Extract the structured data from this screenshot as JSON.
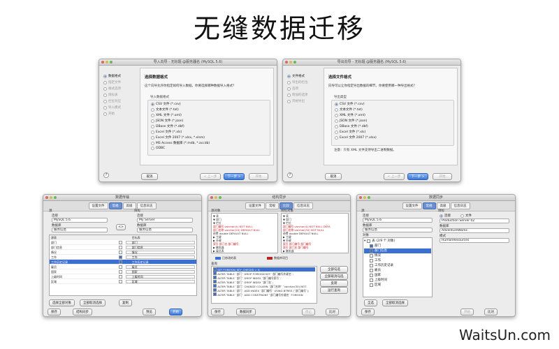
{
  "hero_title": "无缝数据迁移",
  "watermark": "WaitsUn.com",
  "import_win": {
    "title": "导入向导 - 无标题 @服务器名 (MySQL 5.6)",
    "steps": [
      "数据格式",
      "指定文件",
      "格式选项",
      "目标表",
      "栏位对应",
      "导入模式",
      "开始"
    ],
    "panel_title": "选择数据格式",
    "panel_desc": "这个向导允许你指定如何导入数据。你要选择哪种数据导入格式？",
    "group_label": "导入数据格式",
    "formats": [
      "CSV 文件 (*.csv)",
      "文本文件 (*.txt)",
      "XML 文件 (*.xml)",
      "JSON 文件 (*.json)",
      "DBase 文件 (*.dbf)",
      "Excel 文件 (*.xls)",
      "Excel 文件 2007 (*.xlsx, *.xlsm)",
      "MS Access 数据库 (*.mdb, *.accdb)",
      "ODBC"
    ],
    "cancel": "取消",
    "back": "< 上一步",
    "next": "下一步 >",
    "start": "开始",
    "help": "?"
  },
  "export_win": {
    "title": "导出向导 - 无标题 @服务器名 (MySQL 5.6)",
    "steps": [
      "文件格式",
      "导出的栏位",
      "选项",
      "附加的选项",
      "开始导出"
    ],
    "panel_title": "选择文件格式",
    "panel_desc": "向导可以让你指定导出数据的细节。你要使用哪一种导出格式？",
    "group_label": "导出类型",
    "formats": [
      "CSV 文件 (*.csv)",
      "文本文件 (*.txt)",
      "XML 文件 (*.xml)",
      "JSON 文件 (*.json)",
      "DBase 文件 (*.dbf)",
      "Excel 文件 (*.xls)",
      "Excel 文件 2007 (*.xlsx)"
    ],
    "note": "注意：只有 XML 文件支持导出二进制数据。",
    "cancel": "取消",
    "back": "< 上一步",
    "next": "下一步 >",
    "start": "开始",
    "help": "?"
  },
  "transfer_win": {
    "title": "数据传输",
    "tabs": [
      "设置文件",
      "常规",
      "高级",
      "信息日志"
    ],
    "source_label": "源",
    "target_label": "目标",
    "conn_label": "连接",
    "db_label": "数据库",
    "source_conn": "MySQL 5.6",
    "target_conn": "My Server",
    "source_db": "服务信息",
    "target_db": "服务信息",
    "swap": "<>",
    "col_header": "源表",
    "col_header2": "目标表",
    "rows": [
      {
        "a": "部门",
        "b": "部门"
      },
      {
        "a": "部门信息",
        "b": "部门信息"
      },
      {
        "a": "情况",
        "b": "情况"
      },
      {
        "a": "工作",
        "b": "工作"
      },
      {
        "a": "工作历史记录",
        "b": "工作历史记录"
      },
      {
        "a": "雇员",
        "b": "雇员"
      },
      {
        "a": "国家",
        "b": "国家"
      },
      {
        "a": "上级时间",
        "b": "上级时间"
      },
      {
        "a": "区域",
        "b": "区域"
      }
    ],
    "btn_select_all": "选择全部对象",
    "btn_deselect": "全部取消选择",
    "btn_copy": "复制",
    "save": "保存",
    "sync": "结构同步",
    "preview": "预览",
    "start": "开始"
  },
  "sync_win": {
    "title": "结构同步",
    "tabs": [
      "设置文件",
      "常规",
      "比较",
      "信息日志"
    ],
    "left_label": "源对象",
    "right_label": "目标对象",
    "left_code": [
      "▼ 表",
      "  ▼ 部门",
      "    ▼ 栏位",
      "      部门编号 varchar(4) NOT NULL",
      "      部门名称 varchar(20) DEFAULT NULL",
      "      经费 double DEFAULT NULL",
      "    ▶ 主键",
      "    ▶ 外键",
      "      索引 部门名 部门编号",
      "  ▶ 触发器",
      "  ▶ 雇员表"
    ],
    "right_code": [
      "▼ 表",
      "  ▼ 部门",
      "    ▼ 栏位",
      "      部门编号 varchar(4) NOT NULL DEFA",
      "      部门名称 varchar(30) NOT NULL",
      "      经费 double DEFAULT NULL",
      "    ▶ 主键",
      "    ▼ 外键",
      "      索引 部门编号 部门编号",
      "      索引 部门名 部门编号",
      "  ▶ 触发器"
    ],
    "legend1": "已修改的表",
    "legend2": "数据库项目",
    "query_label": "查询",
    "queries": [
      "SET FOREIGN_KEY_CHECKS = 0;",
      "ALTER TABLE `部门` DROP FOREIGN KEY `部门编号外键名`;",
      "ALTER TABLE `部门` DROP INDEX `部门编号索引`;",
      "ALTER TABLE `部门` DROP INDEX `部门名`;",
      "ALTER TABLE `部门` CHANGE COLUMN `部门名称` `varchar(30) NOT",
      "ALTER TABLE `部门` ADD INDEX `部门编号`  USING BTREE (`部门编号`);",
      "ALTER TABLE `部门` ADD CONSTRAINT `部门编号外键名` FOREIGN"
    ],
    "btn_check_all": "全部勾选",
    "btn_uncheck_all": "全部取消勾选",
    "btn_invert": "反转",
    "btn_run": "运行查询",
    "save": "保存",
    "data_sync": "数据同步",
    "stop": "停止",
    "compare": "比对"
  },
  "data_win": {
    "title": "数据同步",
    "tabs": [
      "设置文件",
      "常规",
      "高级",
      "信息日志"
    ],
    "source_label": "源",
    "target_label": "目标",
    "conn_label": "连接",
    "db_label": "数据库",
    "source_conn": "MySQL 5.6",
    "source_db": "服务信息",
    "target_opt1": "连接",
    "target_opt2": "文件",
    "target_conn": "Production Server 02",
    "target_db": "AdventureWorks",
    "schema_label": "模式",
    "target_schema": "HumanResources",
    "obj_label": "对象",
    "tree_root": "表 (2/9 个 对象)",
    "tree_items": [
      "部门",
      "部门信息",
      "情况",
      "工作",
      "工作历史记录",
      "雇员",
      "国家",
      "上级时间",
      "区域"
    ],
    "btn_select_all": "全选",
    "btn_deselect": "全部取消选择",
    "save": "保存",
    "start": "开始",
    "compare": "比对"
  }
}
